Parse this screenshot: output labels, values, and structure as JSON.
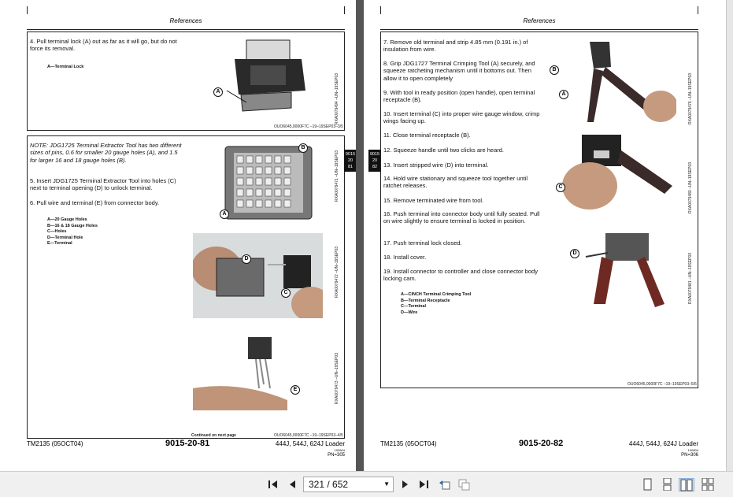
{
  "left_page": {
    "header": "References",
    "step4": "4.  Pull terminal lock (A) out as far as it will go, but do not force its removal.",
    "legend1": "A—Terminal Lock",
    "ref1": "OUO6045,0000F7C  –19–19SEP03–3/5",
    "vref1": "RXA0079494 –UN–19SEP03",
    "note": "NOTE: JDG1725 Terminal Extractor Tool has two different sizes of pins, 0.6 for smaller 20 gauge holes (A), and 1.5 for larger 16 and 18 gauge holes (B).",
    "step5": "5.  Insert JDG1725 Terminal Extractor Tool into holes (C) next to terminal opening (D) to unlock terminal.",
    "step6": "6.  Pull wire and terminal (E) from connector body.",
    "legend2": [
      "A—20 Gauge Holes",
      "B—16 & 18 Gauge Holes",
      "C—Holes",
      "D—Terminal Hole",
      "E—Terminal"
    ],
    "vref2": "RXA0079471 –UN–19SEP03",
    "vref3": "RXA0079472 –UN–19SEP03",
    "vref4": "RXA0079473 –UN–19SEP03",
    "tab": [
      "9015",
      "20",
      "81"
    ],
    "continued": "Continued on next page",
    "ref2": "OUO6045,0000F7C  –19–19SEP03–4/5",
    "footer_left": "TM2135 (05OCT04)",
    "footer_center": "9015-20-81",
    "footer_right": "444J, 544J, 624J Loader",
    "footer_small": "100604",
    "footer_pn": "PN=305"
  },
  "right_page": {
    "header": "References",
    "steps": [
      "7.  Remove old terminal and strip 4.85 mm (0.191 in.) of insulation from wire.",
      "8.  Grip JDG1727 Terminal Crimping Tool (A) securely, and squeeze ratcheting mechanism until it bottoms out. Then allow it to open completely",
      "9.  With tool in ready position (open handle), open terminal receptacle (B).",
      "10. Insert terminal (C) into proper wire gauge window, crimp wings facing up.",
      "11. Close terminal receptacle (B).",
      "12. Squeeze handle until two clicks are heard.",
      "13. Insert stripped wire (D) into terminal.",
      "14. Hold wire stationary and squeeze tool together until ratchet releases.",
      "15. Remove terminated wire from tool.",
      "16. Push terminal into connector body until fully seated. Pull on wire slightly to ensure terminal is locked in position.",
      "17. Push terminal lock closed.",
      "18. Install cover.",
      "19. Install connector to controller and close connector body locking cam."
    ],
    "legend": [
      "A—CINCH Terminal Crimping Tool",
      "B—Terminal Receptacle",
      "C—Terminal",
      "D—Wire"
    ],
    "vref1": "RXA0079476 –UN–19SEP03",
    "vref2": "RXA0079480 –UN–19SEP03",
    "vref3": "RXA0079481 –UN–19SEP03",
    "tab": [
      "9015",
      "20",
      "82"
    ],
    "ref": "OUO6045,0000F7C  –19–19SEP03–5/5",
    "footer_left": "TM2135 (05OCT04)",
    "footer_center": "9015-20-82",
    "footer_right": "444J, 544J, 624J Loader",
    "footer_small": "100604",
    "footer_pn": "PN=306"
  },
  "toolbar": {
    "first_icon": "first-page-icon",
    "prev_icon": "previous-page-icon",
    "page_value": "321 / 652",
    "next_icon": "next-page-icon",
    "last_icon": "last-page-icon",
    "back_icon": "previous-view-icon",
    "forward_icon": "next-view-icon",
    "view_icons": [
      "single-page-view-icon",
      "continuous-view-icon",
      "facing-view-icon",
      "continuous-facing-view-icon"
    ]
  },
  "callouts": [
    "A",
    "B",
    "C",
    "D",
    "E"
  ]
}
